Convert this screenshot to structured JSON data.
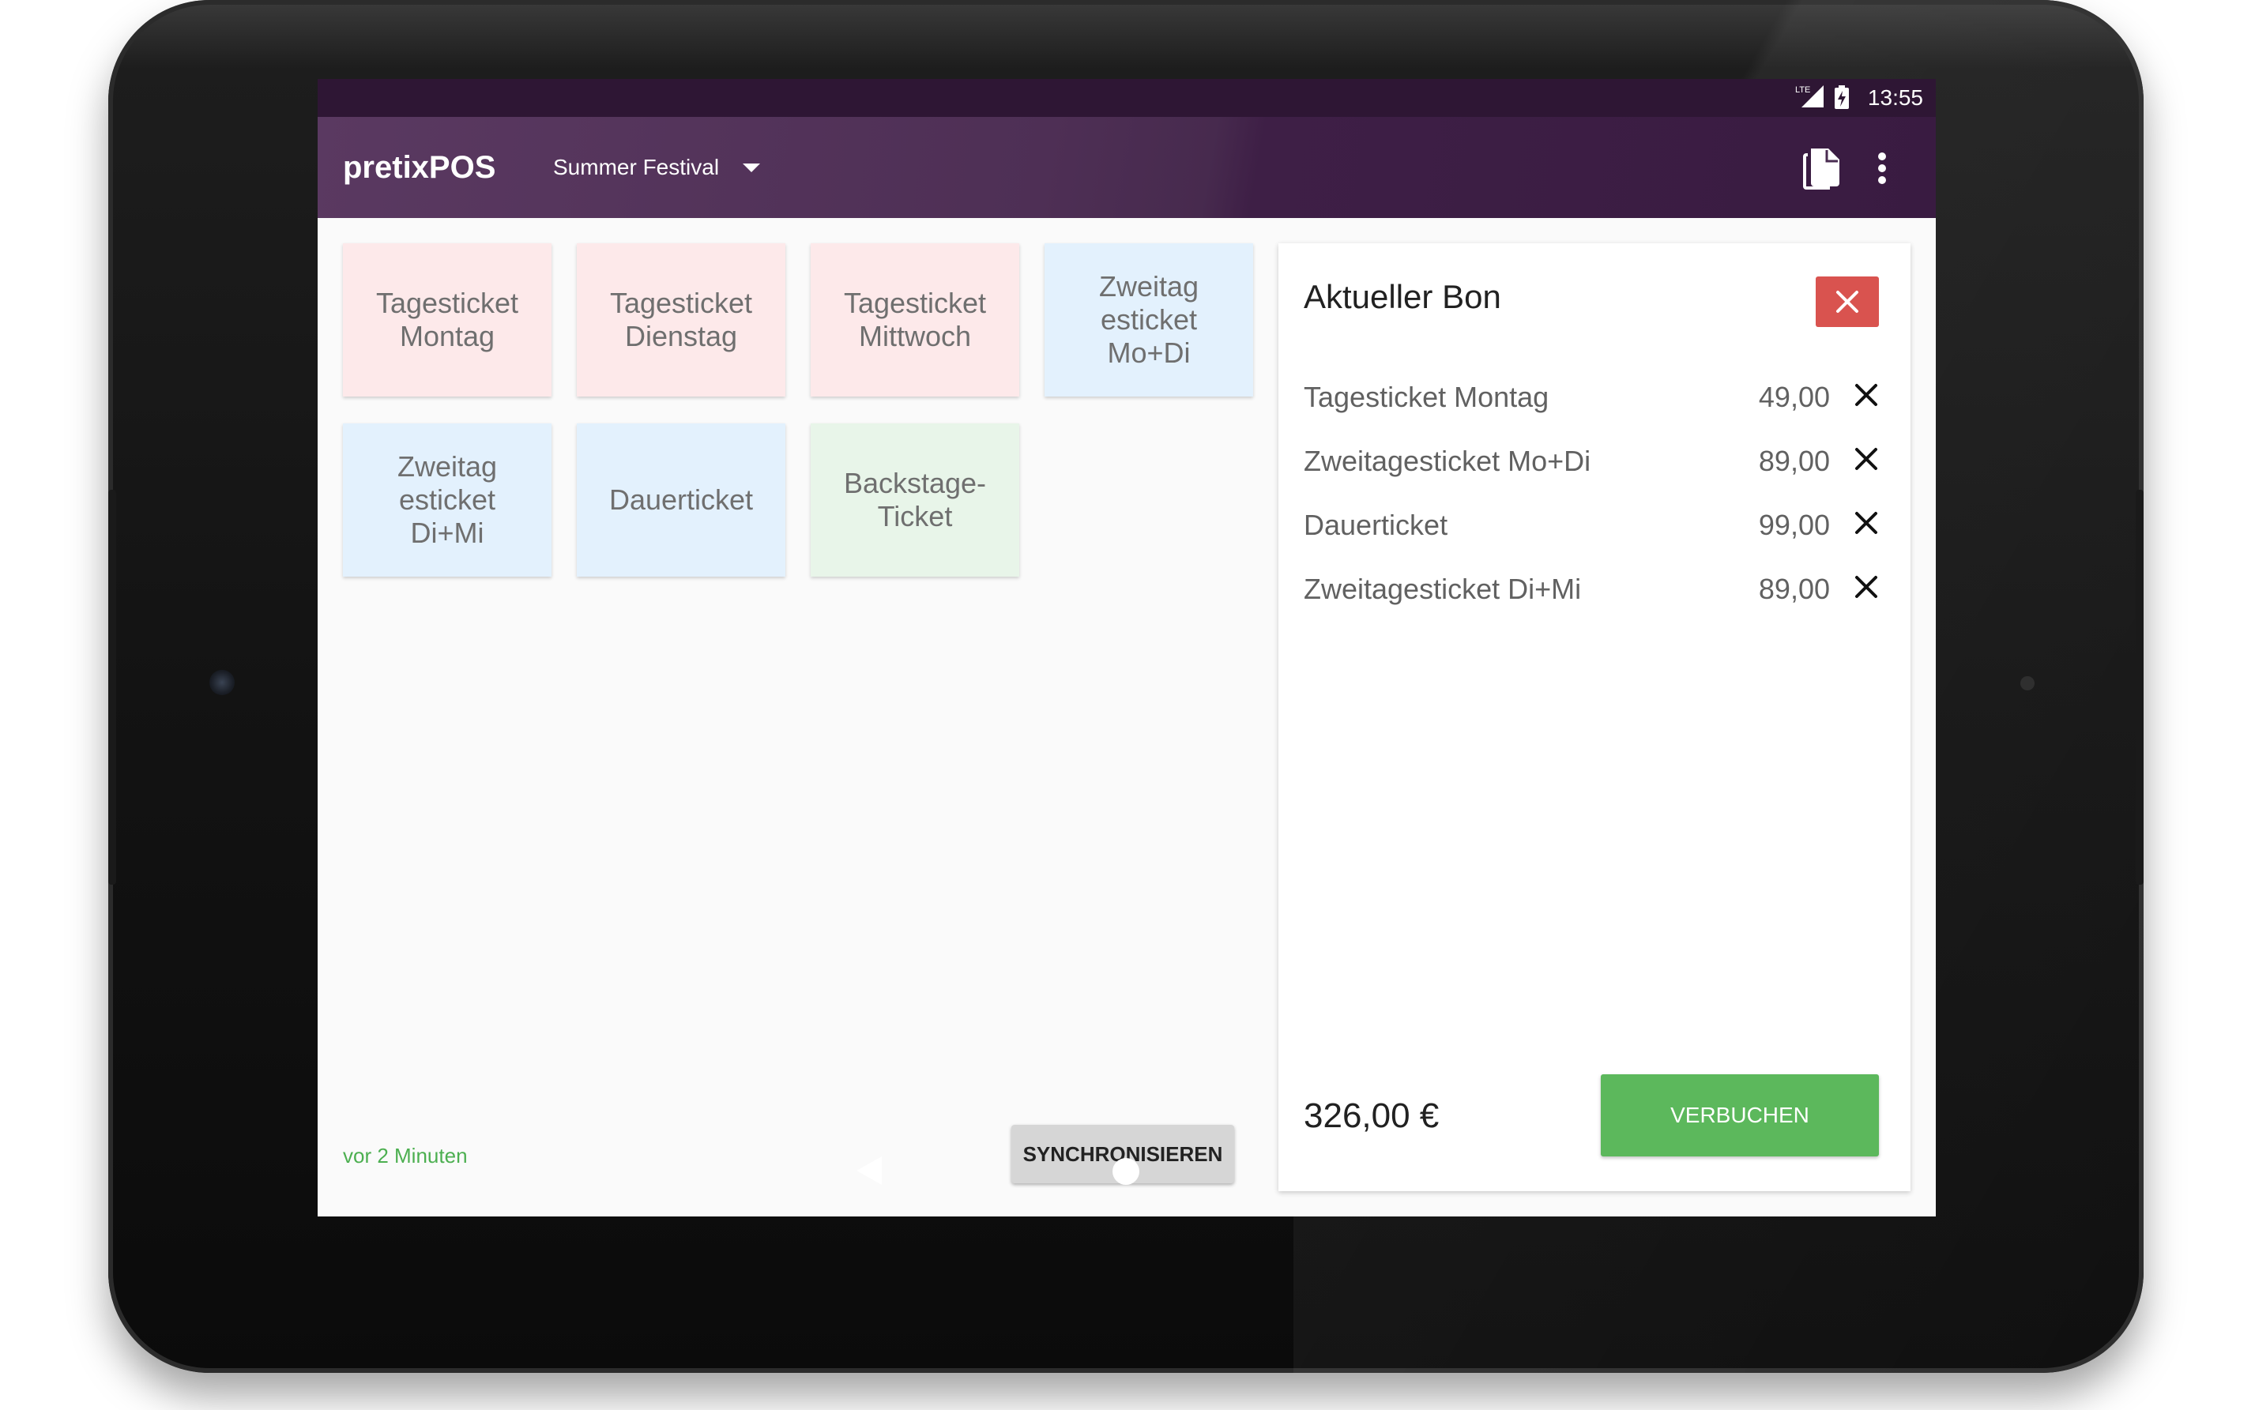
{
  "colors": {
    "status_bar": "#2e1634",
    "app_bar": "#4e2f55",
    "tile_red": "#fde9ea",
    "tile_blue": "#e3f1fd",
    "tile_green": "#e8f5e9",
    "accent_green": "#5cb85c",
    "danger_red": "#d9534f",
    "sync_text": "#4caf50"
  },
  "status_bar": {
    "time": "13:55",
    "network_icon": "lte-signal-icon",
    "battery_icon": "battery-charging-icon"
  },
  "app_bar": {
    "title": "pretixPOS",
    "event_name": "Summer Festival",
    "actions": [
      "document-icon",
      "more-vert-icon"
    ]
  },
  "products": [
    {
      "label": "Tagesticket\nMontag",
      "color": "red"
    },
    {
      "label": "Tagesticket\nDienstag",
      "color": "red"
    },
    {
      "label": "Tagesticket\nMittwoch",
      "color": "red"
    },
    {
      "label": "Zweitag\nesticket\nMo+Di",
      "color": "blue"
    },
    {
      "label": "Zweitag\nesticket\nDi+Mi",
      "color": "blue"
    },
    {
      "label": "Dauerticket",
      "color": "blue"
    },
    {
      "label": "Backstage-\nTicket",
      "color": "green"
    }
  ],
  "sync": {
    "last_sync": "vor 2 Minuten",
    "button_label": "SYNCHRONISIEREN"
  },
  "receipt": {
    "title": "Aktueller Bon",
    "items": [
      {
        "name": "Tagesticket Montag",
        "price": "49,00"
      },
      {
        "name": "Zweitagesticket Mo+Di",
        "price": "89,00"
      },
      {
        "name": "Dauerticket",
        "price": "99,00"
      },
      {
        "name": "Zweitagesticket Di+Mi",
        "price": "89,00"
      }
    ],
    "total": "326,00 €",
    "book_label": "VERBUCHEN"
  },
  "nav": [
    "back-icon",
    "home-icon",
    "recents-icon"
  ]
}
